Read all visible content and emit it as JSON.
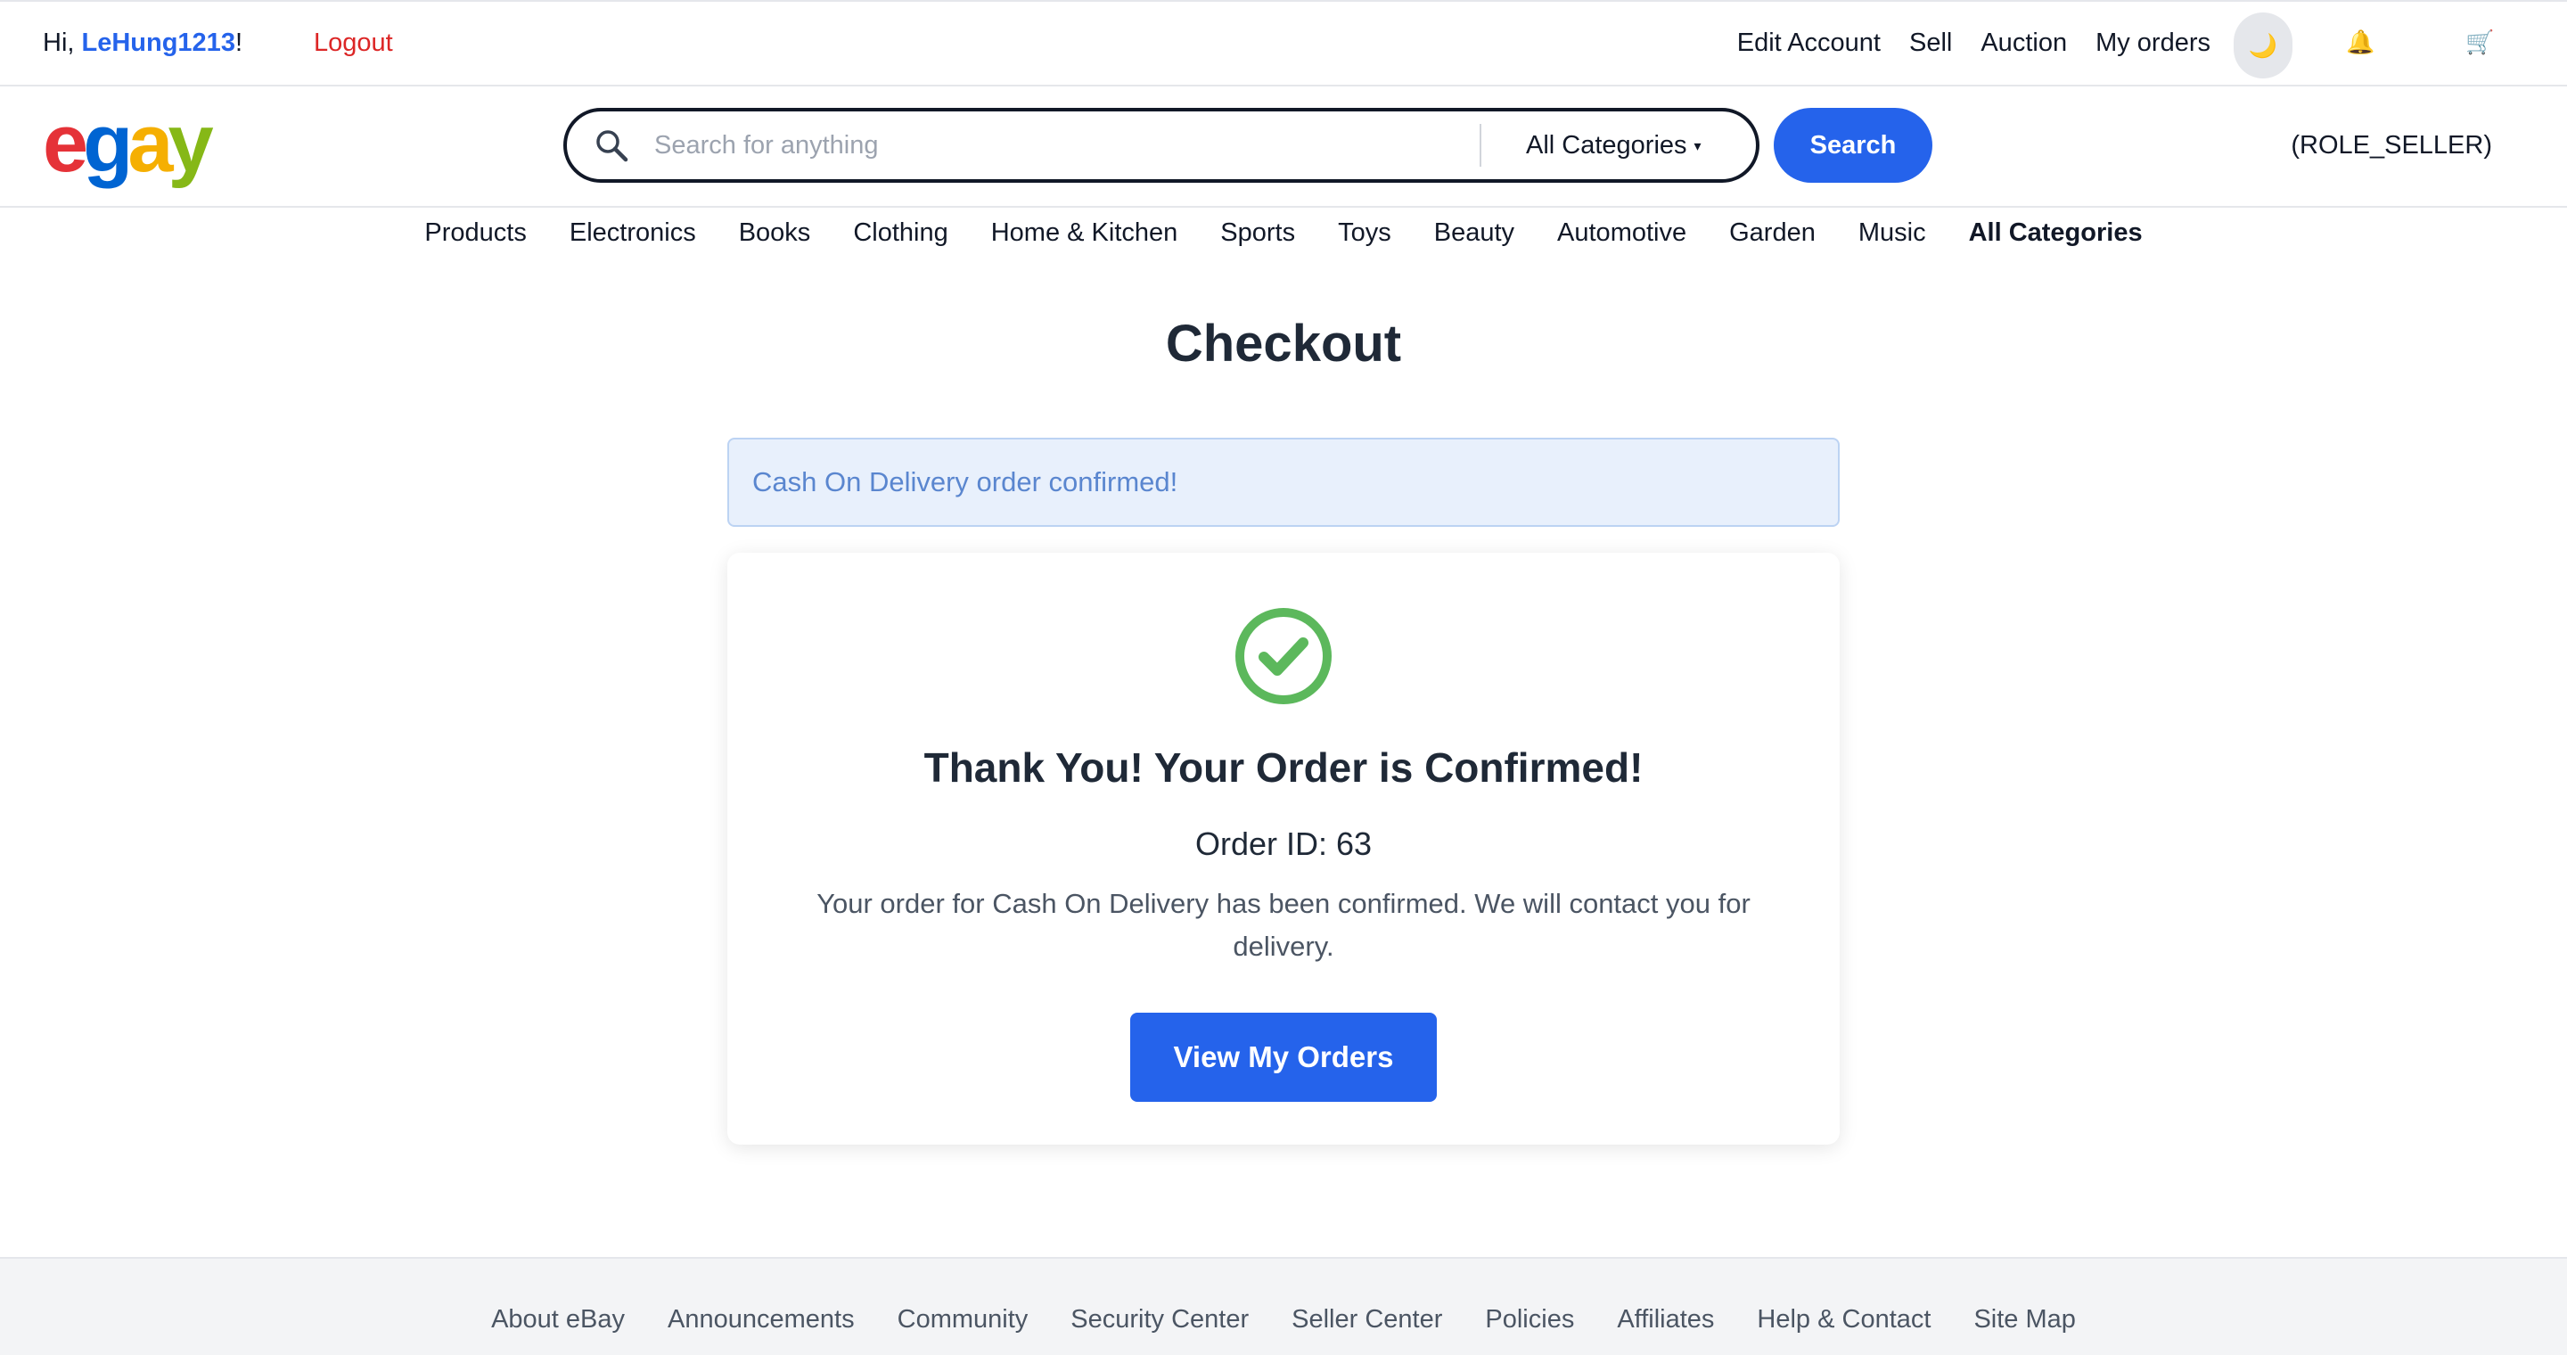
{
  "topbar": {
    "greeting_prefix": "Hi, ",
    "username": "LeHung1213",
    "greeting_suffix": "!",
    "logout": "Logout",
    "links": [
      "Edit Account",
      "Sell",
      "Auction",
      "My orders"
    ],
    "theme_icon": "🌙",
    "bell_icon": "🔔",
    "cart_icon": "🛒"
  },
  "header": {
    "logo": [
      "e",
      "g",
      "a",
      "y"
    ],
    "search_placeholder": "Search for anything",
    "category_select": "All Categories",
    "search_button": "Search",
    "role": "(ROLE_SELLER)"
  },
  "nav": {
    "categories": [
      "Products",
      "Electronics",
      "Books",
      "Clothing",
      "Home & Kitchen",
      "Sports",
      "Toys",
      "Beauty",
      "Automotive",
      "Garden",
      "Music"
    ],
    "all_categories": "All Categories"
  },
  "main": {
    "title": "Checkout",
    "alert": "Cash On Delivery order confirmed!",
    "card": {
      "heading": "Thank You! Your Order is Confirmed!",
      "order_id": "Order ID: 63",
      "message": "Your order for Cash On Delivery has been confirmed. We will contact you for delivery.",
      "button": "View My Orders"
    }
  },
  "footer": {
    "links": [
      "About eBay",
      "Announcements",
      "Community",
      "Security Center",
      "Seller Center",
      "Policies",
      "Affiliates",
      "Help & Contact",
      "Site Map"
    ]
  },
  "colors": {
    "accent": "#2563eb",
    "logout": "#dc2626",
    "success": "#5cb85c",
    "alert_bg": "#e8f0fc"
  }
}
